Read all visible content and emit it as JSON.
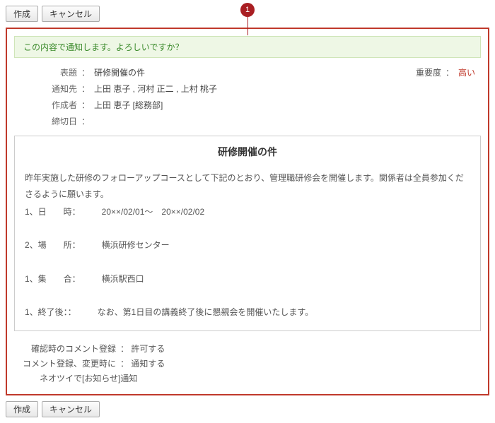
{
  "annotation": "1",
  "buttons": {
    "create": "作成",
    "cancel": "キャンセル"
  },
  "confirmMessage": "この内容で通知します。よろしいですか？",
  "meta": {
    "subjectLabel": "表題",
    "subjectValue": "研修開催の件",
    "priorityLabel": "重要度",
    "priorityValue": "高い",
    "recipientsLabel": "通知先",
    "recipientsValue": "上田 恵子 , 河村 正二 , 上村 桃子",
    "authorLabel": "作成者",
    "authorValue": "上田 恵子 [総務部]",
    "deadlineLabel": "締切日",
    "deadlineValue": ""
  },
  "content": {
    "title": "研修開催の件",
    "intro": "昨年実施した研修のフォローアップコースとして下記のとおり、管理職研修会を開催します。関係者は全員参加くださるように願います。",
    "line1": "1、日　　時：　　　20××/02/01～　20××/02/02",
    "line2": "2、場　　所：　　　横浜研修センター",
    "line3": "1、集　　合：　　　横浜駅西口",
    "line4": "1、終了後：：　　　なお、第1日目の講義終了後に懇親会を開催いたします。"
  },
  "settings": {
    "confirmCommentLabel": "確認時のコメント登録",
    "confirmCommentValue": "許可する",
    "commentChangeLabel": "コメント登録、変更時に",
    "commentChangeValue": "通知する",
    "neotwi": "ネオツイで[お知らせ]通知"
  }
}
